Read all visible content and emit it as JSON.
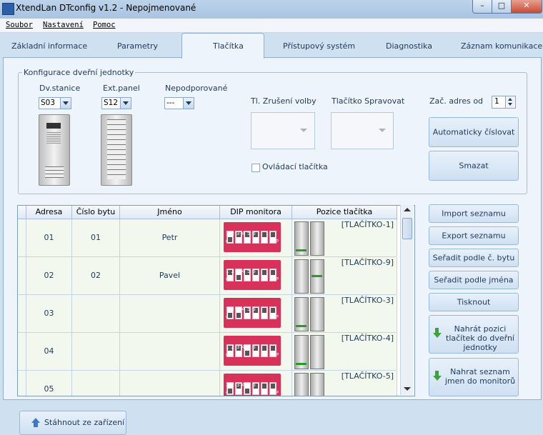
{
  "window": {
    "title": "XtendLan DTconfig v1.2 - Nepojmenované"
  },
  "menu": [
    "Soubor",
    "Nastavení",
    "Pomoc"
  ],
  "tabs": [
    "Základní informace",
    "Parametry",
    "Tlačítka",
    "Přístupový systém",
    "Diagnostika",
    "Záznam komunikace"
  ],
  "active_tab": "Tlačítka",
  "config": {
    "group_title": "Konfigurace dveřní jednotky",
    "dv_stanice_label": "Dv.stanice",
    "dv_stanice_value": "S03",
    "ext_panel_label": "Ext.panel",
    "ext_panel_value": "S12",
    "nepodporovane_label": "Nepodporované",
    "nepodporovane_value": "---",
    "zruseni_label": "Tl. Zrušení volby",
    "spravovat_label": "Tlačítko Spravovat",
    "ovladaci_label": "Ovládací tlačítka",
    "zac_adres_label": "Zač. adres od",
    "zac_adres_value": "1",
    "auto_button": "Automaticky číslovat",
    "smazat_button": "Smazat"
  },
  "table": {
    "headers": [
      "Adresa",
      "Číslo bytu",
      "Jméno",
      "DIP monitora",
      "Pozice tlačítka"
    ],
    "dip_on": "ON",
    "dip_dp": "DP",
    "dip_nums": "123456",
    "rows": [
      {
        "adresa": "01",
        "cislo": "01",
        "jmeno": "Petr",
        "pozice": "[TLAČÍTKO-1]",
        "dip": [
          0,
          1,
          1,
          1,
          1,
          1
        ],
        "marker": "left"
      },
      {
        "adresa": "02",
        "cislo": "02",
        "jmeno": "Pavel",
        "pozice": "[TLAČÍTKO-9]",
        "dip": [
          1,
          0,
          1,
          1,
          1,
          1
        ],
        "marker": "right"
      },
      {
        "adresa": "03",
        "cislo": "",
        "jmeno": "",
        "pozice": "[TLAČÍTKO-3]",
        "dip": [
          0,
          0,
          1,
          1,
          1,
          1
        ],
        "marker": "left"
      },
      {
        "adresa": "04",
        "cislo": "",
        "jmeno": "",
        "pozice": "[TLAČÍTKO-4]",
        "dip": [
          1,
          1,
          0,
          1,
          1,
          1
        ],
        "marker": "left"
      },
      {
        "adresa": "05",
        "cislo": "",
        "jmeno": "",
        "pozice": "[TLAČÍTKO-5]",
        "dip": [
          0,
          1,
          0,
          1,
          1,
          1
        ],
        "marker": "left"
      }
    ]
  },
  "side_buttons": {
    "import": "Import seznamu",
    "export": "Export seznamu",
    "sort_byt": "Seřadit podle č. bytu",
    "sort_jmeno": "Seřadit podle jména",
    "tisk": "Tisknout",
    "nahrat_pozici": "Nahrát pozici tlačítek do dveřní jednotky",
    "nahrat_seznam": "Nahrat seznam jmen do monitorů"
  },
  "download_button": "Stáhnout ze zařízení",
  "colors": {
    "accent": "#1e395b",
    "dip": "#d8325b",
    "marker": "#2a9a2a"
  }
}
